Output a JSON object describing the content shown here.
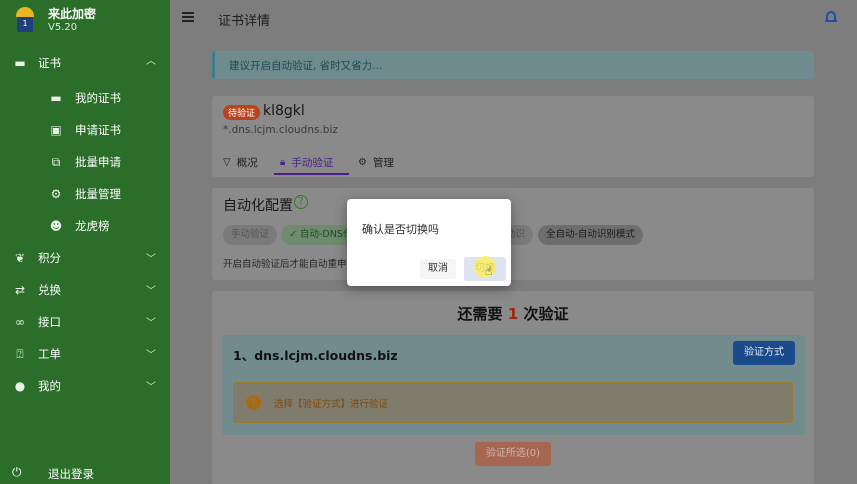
{
  "brand": {
    "name": "来此加密",
    "version": "V5.20",
    "logo_number": "1"
  },
  "sidebar": {
    "items": [
      {
        "label": "证书",
        "icon": "card-icon",
        "expanded": true
      },
      {
        "label": "我的证书",
        "icon": "certificate-icon"
      },
      {
        "label": "申请证书",
        "icon": "add-card-icon"
      },
      {
        "label": "批量申请",
        "icon": "copy-icon"
      },
      {
        "label": "批量管理",
        "icon": "gears-icon"
      },
      {
        "label": "龙虎榜",
        "icon": "alien-icon"
      },
      {
        "label": "积分",
        "icon": "leaf-icon"
      },
      {
        "label": "兑换",
        "icon": "swap-icon"
      },
      {
        "label": "接口",
        "icon": "link-icon"
      },
      {
        "label": "工单",
        "icon": "help-box-icon"
      },
      {
        "label": "我的",
        "icon": "account-icon"
      }
    ],
    "logout": "退出登录"
  },
  "header": {
    "title": "证书详情"
  },
  "tip": "建议开启自动验证, 省时又省力...",
  "cert": {
    "status": "待验证",
    "name": "kl8gkl",
    "domain": "*.dns.lcjm.cloudns.biz",
    "tabs": [
      "概况",
      "手动验证",
      "管理"
    ],
    "active_tab": "手动验证"
  },
  "automation": {
    "title": "自动化配置",
    "options": [
      "手动验证",
      "✓ 自动-DNS代",
      "动识",
      "全自动-自动识别模式"
    ],
    "note": "开启自动验证后才能自动重申"
  },
  "verify": {
    "prefix": "还需要",
    "count": "1",
    "suffix": "次验证",
    "domain_entry": "1、dns.lcjm.cloudns.biz",
    "method_button": "验证方式",
    "warning": "选择【验证方式】进行验证",
    "submit_button": "验证所选(0)"
  },
  "dialog": {
    "message": "确认是否切换吗",
    "cancel": "取消",
    "confirm": "切换"
  },
  "colors": {
    "sidebar": "#2a6e29",
    "accent_purple": "#4a1e8a",
    "primary_blue": "#1b4a8a",
    "badge_red": "#b8431c"
  }
}
